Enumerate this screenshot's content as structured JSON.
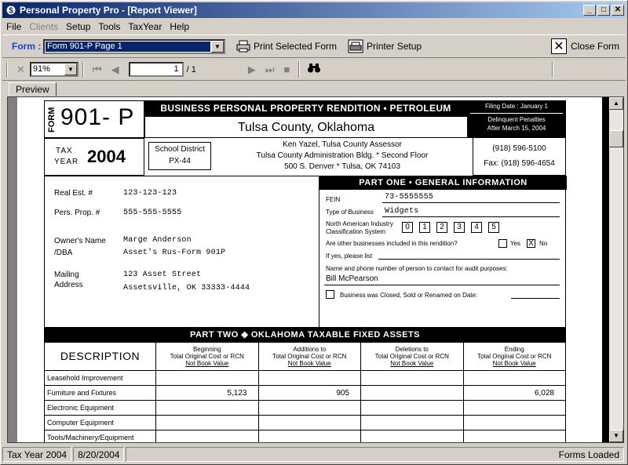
{
  "window": {
    "title": "Personal Property Pro - [Report Viewer]"
  },
  "menu": [
    "File",
    "Clients",
    "Setup",
    "Tools",
    "TaxYear",
    "Help"
  ],
  "toolbar": {
    "form_label": "Form :",
    "form_value": "Form 901-P Page 1",
    "print_selected": "Print Selected Form",
    "printer_setup": "Printer Setup",
    "close_form": "Close Form"
  },
  "viewer_toolbar": {
    "zoom": "91%",
    "page": "1",
    "page_total": "/ 1"
  },
  "tabs": [
    "Preview"
  ],
  "form": {
    "form_word": "FORM",
    "form_number": "901- P",
    "header_title": "BUSINESS PERSONAL PROPERTY RENDITION  • PETROLEUM RELATED",
    "county": "Tulsa County, Oklahoma",
    "filing_date": "Filing Date : January 1",
    "delinquent_1": "Delinquent Penalties",
    "delinquent_2": "After March 15, 2004",
    "tax": "TAX",
    "year_word": "YEAR",
    "year": "2004",
    "school_district_label": "School District",
    "school_district": "PX-44",
    "assessor_1": "Ken Yazel, Tulsa County Assessor",
    "assessor_2": "Tulsa County Administration Bldg. * Second Floor",
    "assessor_3": "500 S. Denver * Tulsa, OK  74103",
    "phone": "(918) 596-5100",
    "fax": "Fax: (918) 596-4654",
    "real_est_label": "Real Est. #",
    "real_est": "123-123-123",
    "pers_prop_label": "Pers. Prop. #",
    "pers_prop": "555-555-5555",
    "owner_label_1": "Owner's Name",
    "owner_label_2": "/DBA",
    "owner": "Marge Anderson",
    "dba": "Asset's Rus-Form 901P",
    "mailing_label_1": "Mailing",
    "mailing_label_2": "Address",
    "address_1": "123 Asset Street",
    "address_2": "Assetsville, OK 33333-4444",
    "part_one": "PART ONE  •  GENERAL INFORMATION",
    "fein_label": "FEIN",
    "fein": "73-5555555",
    "business_type_label": "Type of Business",
    "business_type": "Widgets",
    "naics_label_1": "North American Industry",
    "naics_label_2": "Classification System",
    "naics_digits": [
      "0",
      "1",
      "2",
      "3",
      "4",
      "5"
    ],
    "other_business_q": "Are other businesses included in this rendition?",
    "yes": "Yes",
    "no": "No",
    "no_mark": "X",
    "if_yes": "If yes, please list",
    "contact_label": "Name and phone number of person to contact for audit purposes:",
    "contact": "Bill McPearson",
    "closed_label": "Business was Closed, Sold or Renamed on Date:",
    "part_two": "PART TWO  ◆ OKLAHOMA TAXABLE FIXED ASSETS",
    "col_description": "DESCRIPTION",
    "columns": [
      {
        "l1": "Beginning",
        "l2": "Total Original Cost or RCN",
        "l3": "Not Book Value"
      },
      {
        "l1": "Additions to",
        "l2": "Total Original Cost or RCN",
        "l3": "Not Book Value"
      },
      {
        "l1": "Deletions to",
        "l2": "Total Original Cost or RCN",
        "l3": "Not Book Value"
      },
      {
        "l1": "Ending",
        "l2": "Total Original Cost or RCN",
        "l3": "Not Book Value"
      }
    ],
    "rows": [
      {
        "desc": "Leasehold Improvement",
        "c1": "",
        "c2": "",
        "c3": "",
        "c4": ""
      },
      {
        "desc": "Furniture and Fixtures",
        "c1": "5,123",
        "c2": "905",
        "c3": "",
        "c4": "6,028"
      },
      {
        "desc": "Electronic Equipment",
        "c1": "",
        "c2": "",
        "c3": "",
        "c4": ""
      },
      {
        "desc": "Computer Equipment",
        "c1": "",
        "c2": "",
        "c3": "",
        "c4": ""
      },
      {
        "desc": "Tools/Machinery/Equipment",
        "c1": "",
        "c2": "",
        "c3": "",
        "c4": ""
      }
    ]
  },
  "status": {
    "tax_year": "Tax Year 2004",
    "date": "8/20/2004",
    "message": "Forms Loaded"
  }
}
